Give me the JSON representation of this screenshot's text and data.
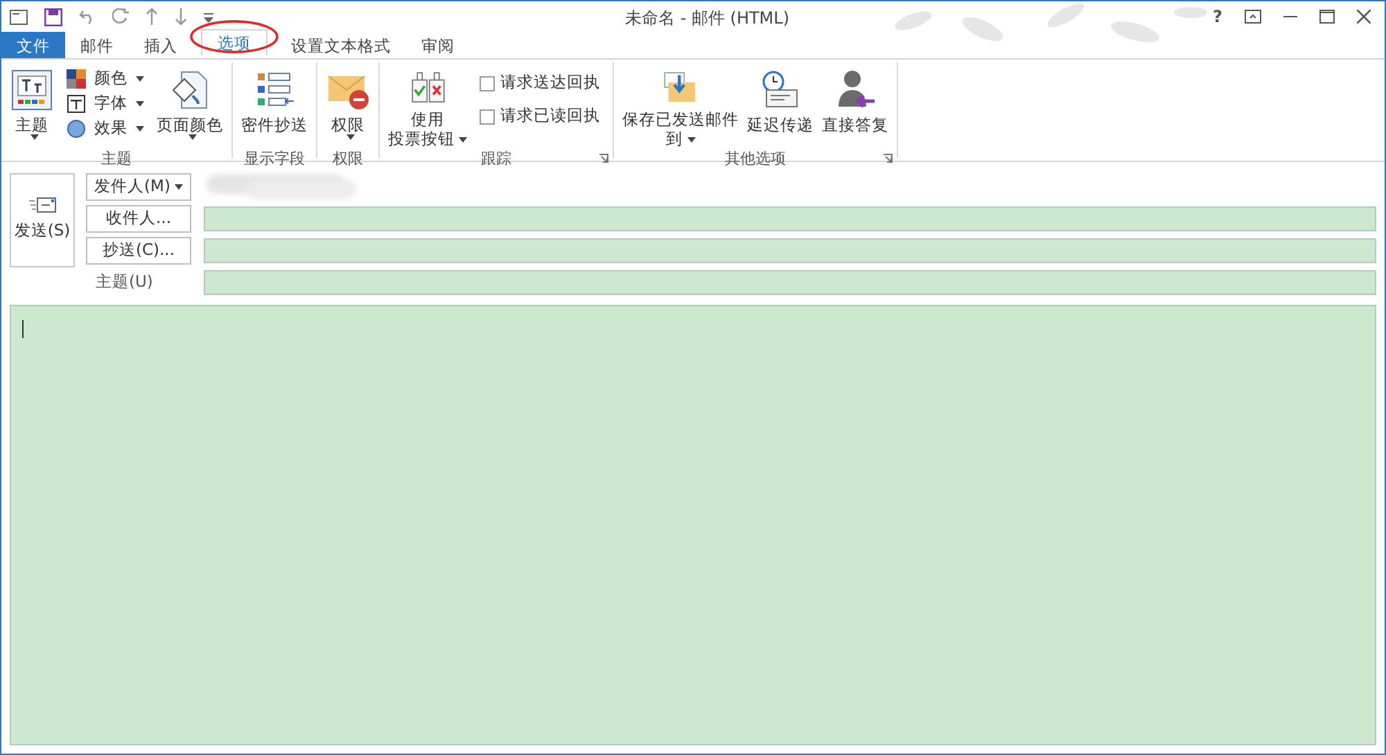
{
  "window": {
    "title": "未命名 - 邮件 (HTML)",
    "help": "?"
  },
  "tabs": [
    {
      "label": "文件",
      "kind": "file",
      "selected": false
    },
    {
      "label": "邮件",
      "kind": "normal",
      "selected": false
    },
    {
      "label": "插入",
      "kind": "normal",
      "selected": false
    },
    {
      "label": "选项",
      "kind": "normal",
      "selected": true
    },
    {
      "label": "设置文本格式",
      "kind": "normal",
      "selected": false
    },
    {
      "label": "审阅",
      "kind": "normal",
      "selected": false
    }
  ],
  "ribbon": {
    "groups": [
      {
        "label": "主题",
        "launcher": false,
        "items": [
          {
            "kind": "large",
            "lines": [
              "主题"
            ],
            "dropdown": true
          },
          {
            "kind": "stack",
            "items": [
              {
                "kind": "small",
                "label": "颜色",
                "dropdown": true
              },
              {
                "kind": "small",
                "label": "字体",
                "dropdown": true
              },
              {
                "kind": "small",
                "label": "效果",
                "dropdown": true
              }
            ]
          },
          {
            "kind": "large",
            "lines": [
              "页面颜色"
            ],
            "dropdown": true
          }
        ]
      },
      {
        "label": "显示字段",
        "launcher": false,
        "items": [
          {
            "kind": "large",
            "lines": [
              "密件抄送"
            ],
            "dropdown": false
          }
        ]
      },
      {
        "label": "权限",
        "launcher": false,
        "items": [
          {
            "kind": "large",
            "lines": [
              "权限"
            ],
            "dropdown": true
          }
        ]
      },
      {
        "label": "跟踪",
        "launcher": true,
        "items": [
          {
            "kind": "large",
            "lines": [
              "使用",
              "投票按钮"
            ],
            "dropdown": true
          },
          {
            "kind": "stack",
            "items": [
              {
                "kind": "check",
                "label": "请求送达回执",
                "checked": false
              },
              {
                "kind": "check",
                "label": "请求已读回执",
                "checked": false
              }
            ]
          }
        ]
      },
      {
        "label": "其他选项",
        "launcher": true,
        "items": [
          {
            "kind": "large",
            "lines": [
              "保存已发送邮件",
              "到"
            ],
            "dropdown": true
          },
          {
            "kind": "large",
            "lines": [
              "延迟传递"
            ],
            "dropdown": false
          },
          {
            "kind": "large",
            "lines": [
              "直接答复"
            ],
            "dropdown": false
          }
        ]
      }
    ]
  },
  "compose": {
    "send_button": "发送(S)",
    "rows": [
      {
        "kind": "from",
        "button": "发件人(M)",
        "dropdown": true
      },
      {
        "kind": "field",
        "button": "收件人..."
      },
      {
        "kind": "field",
        "button": "抄送(C)..."
      },
      {
        "kind": "label",
        "label": "主题(U)"
      }
    ]
  }
}
